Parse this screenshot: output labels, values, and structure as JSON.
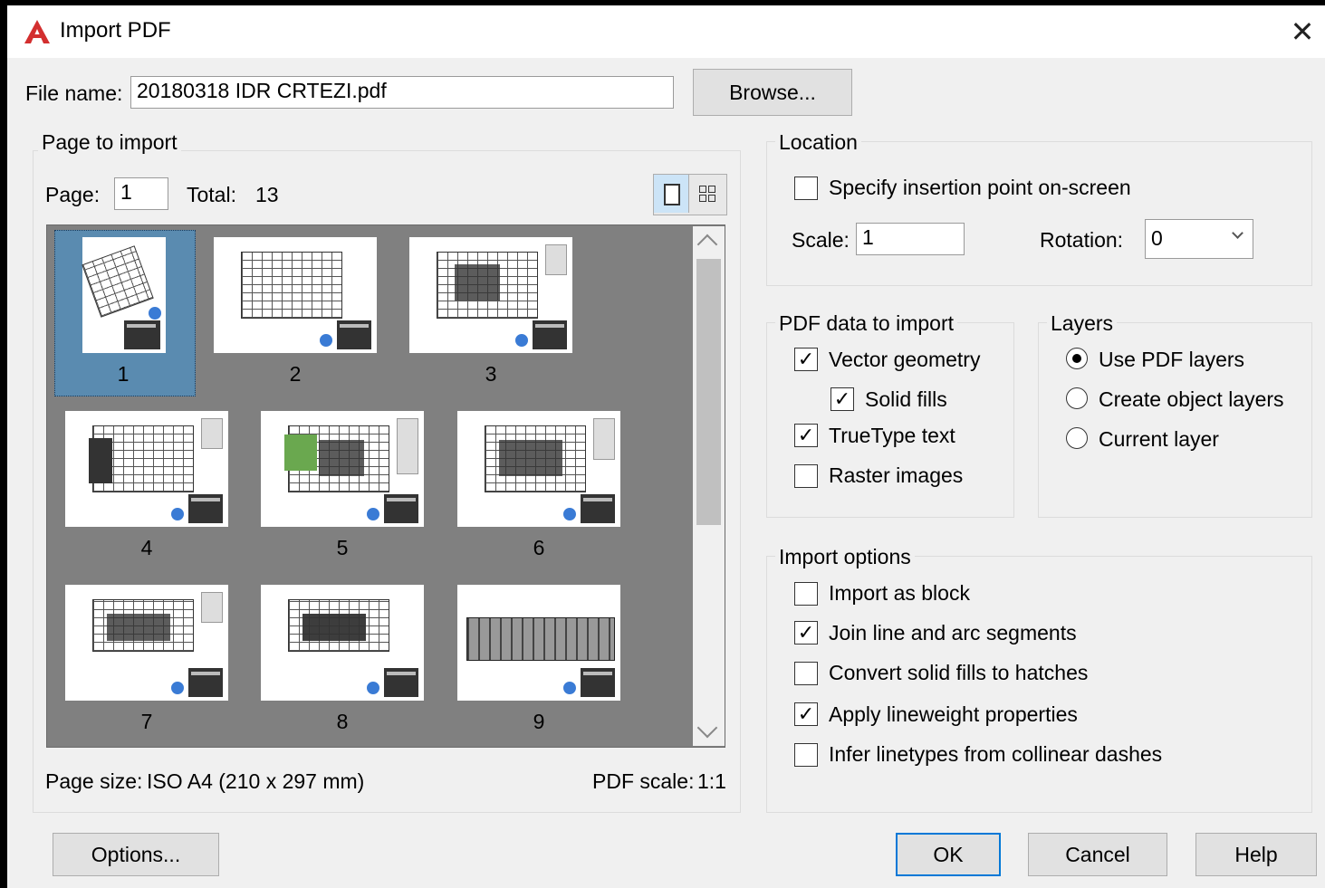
{
  "window": {
    "title": "Import PDF",
    "close_glyph": "✕"
  },
  "file": {
    "label": "File name:",
    "value": "20180318 IDR CRTEZI.pdf",
    "browse_label": "Browse..."
  },
  "page_to_import": {
    "title": "Page to import",
    "page_label": "Page:",
    "page_value": "1",
    "total_label": "Total:",
    "total_value": "13",
    "view_single_icon": "single-page-view-icon",
    "view_grid_icon": "grid-view-icon",
    "thumbnails": [
      {
        "number": "1",
        "selected": true
      },
      {
        "number": "2",
        "selected": false
      },
      {
        "number": "3",
        "selected": false
      },
      {
        "number": "4",
        "selected": false
      },
      {
        "number": "5",
        "selected": false
      },
      {
        "number": "6",
        "selected": false
      },
      {
        "number": "7",
        "selected": false
      },
      {
        "number": "8",
        "selected": false
      },
      {
        "number": "9",
        "selected": false
      }
    ],
    "page_size_label": "Page size:",
    "page_size_value": "ISO A4 (210 x 297 mm)",
    "pdf_scale_label": "PDF scale:",
    "pdf_scale_value": "1:1"
  },
  "location": {
    "title": "Location",
    "specify_insertion": "Specify insertion point on-screen",
    "specify_checked": false,
    "scale_label": "Scale:",
    "scale_value": "1",
    "rotation_label": "Rotation:",
    "rotation_value": "0"
  },
  "pdf_data": {
    "title": "PDF data to import",
    "vector_geometry": "Vector geometry",
    "vector_checked": true,
    "solid_fills": "Solid fills",
    "solid_checked": true,
    "truetype_text": "TrueType text",
    "truetype_checked": true,
    "raster_images": "Raster images",
    "raster_checked": false
  },
  "layers": {
    "title": "Layers",
    "use_pdf_layers": "Use PDF layers",
    "create_object_layers": "Create object layers",
    "current_layer": "Current layer",
    "selected": "use_pdf_layers"
  },
  "import_options": {
    "title": "Import options",
    "import_as_block": "Import as block",
    "block_checked": false,
    "join_line_arc": "Join line and arc segments",
    "join_checked": true,
    "convert_solid_fills": "Convert solid fills to hatches",
    "convert_checked": false,
    "apply_lineweight": "Apply lineweight properties",
    "lineweight_checked": true,
    "infer_linetypes": "Infer linetypes from collinear dashes",
    "infer_checked": false
  },
  "buttons": {
    "options": "Options...",
    "ok": "OK",
    "cancel": "Cancel",
    "help": "Help"
  },
  "colors": {
    "accent": "#0078d7",
    "thumb_bg": "#808080",
    "selection": "#5a8bb0",
    "logo_red": "#d32f2f"
  }
}
